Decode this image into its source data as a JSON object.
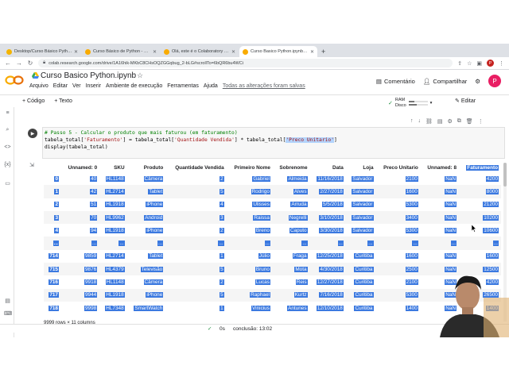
{
  "browser": {
    "tabs": [
      "Desktop/Curso Básico Python/",
      "Curso Básico de Python - Google",
      "Olá, este é o Colaboratory - Cola",
      "Curso Basico Python.ipynb - Cola"
    ],
    "url": "colab.research.google.com/drive/1A16hik-MKbC8CHsOQZGGqbug_2-bLG#scrollTo=6bQR6bu4WCi",
    "profile_initial": "P"
  },
  "colab": {
    "title": "Curso Basico Python.ipynb",
    "menus": [
      "Arquivo",
      "Editar",
      "Ver",
      "Inserir",
      "Ambiente de execução",
      "Ferramentas",
      "Ajuda"
    ],
    "saved": "Todas as alterações foram salvas",
    "comment": "Comentário",
    "share": "Compartilhar",
    "avatar": "P",
    "add_code": "+ Código",
    "add_text": "+ Texto",
    "ram": "RAM",
    "disk": "Disco",
    "edit": "Editar",
    "resources": {
      "ram_fraction": 0.3,
      "disk_fraction": 0.45
    }
  },
  "cell": {
    "lines": [
      "# Passo 5 - Calcular o produto que mais faturou (em faturamento)",
      "",
      "display(tabela_total)"
    ],
    "l2": {
      "a": "tabela_total[",
      "b": "'Faturamento'",
      "c": "] = tabela_total[",
      "d": "'Quantidade Vendida'",
      "e": "] * tabela_total[",
      "f": "'Preco Unitario'",
      "g": "]"
    }
  },
  "table": {
    "columns": [
      "Unnamed: 0",
      "SKU",
      "Produto",
      "Quantidade Vendida",
      "Primeiro Nome",
      "Sobrenome",
      "Data",
      "Loja",
      "Preco Unitario",
      "Unnamed: 8",
      "Faturamento"
    ],
    "rows": [
      [
        "0",
        "40",
        "HL1148",
        "Câmera",
        "2",
        "Gabriel",
        "Almeida",
        "11/16/2018",
        "Salvador",
        "2100",
        "NaN",
        "4200"
      ],
      [
        "1",
        "42",
        "HL2714",
        "Tablet",
        "5",
        "Rodrigo",
        "Alves",
        "2/27/2018",
        "Salvador",
        "1600",
        "NaN",
        "8000"
      ],
      [
        "2",
        "51",
        "HL1918",
        "iPhone",
        "4",
        "Ulisses",
        "Arruda",
        "5/5/2018",
        "Salvador",
        "5300",
        "NaN",
        "21200"
      ],
      [
        "3",
        "70",
        "HL9962",
        "Android",
        "3",
        "Raissa",
        "Negrelli",
        "3/10/2018",
        "Salvador",
        "3400",
        "NaN",
        "10200"
      ],
      [
        "4",
        "94",
        "HL1918",
        "iPhone",
        "2",
        "Breno",
        "Caputo",
        "3/30/2018",
        "Salvador",
        "5300",
        "NaN",
        "10600"
      ],
      [
        "...",
        "...",
        "...",
        "...",
        "...",
        "...",
        "...",
        "...",
        "...",
        "...",
        "...",
        "..."
      ],
      [
        "714",
        "9859",
        "HL2714",
        "Tablet",
        "1",
        "Júlio",
        "Fraga",
        "12/25/2018",
        "Curitiba",
        "1600",
        "NaN",
        "1600"
      ],
      [
        "715",
        "9876",
        "HL4379",
        "Televisão",
        "5",
        "Bruno",
        "Mota",
        "4/30/2018",
        "Curitiba",
        "2500",
        "NaN",
        "12500"
      ],
      [
        "716",
        "9918",
        "HL1148",
        "Câmera",
        "2",
        "Lucas",
        "Reis",
        "12/27/2018",
        "Curitiba",
        "2100",
        "NaN",
        "4200"
      ],
      [
        "717",
        "9944",
        "HL1918",
        "iPhone",
        "5",
        "Raphael",
        "Kurtz",
        "7/16/2018",
        "Curitiba",
        "5300",
        "NaN",
        "26500"
      ],
      [
        "718",
        "9998",
        "HL7348",
        "SmartWatch",
        "1",
        "Vinicius",
        "Antunes",
        "12/10/2018",
        "Curitiba",
        "1400",
        "NaN",
        "1400"
      ]
    ],
    "size": "9999 rows × 11 columns"
  },
  "status": {
    "duration": "0s",
    "completed": "conclusão: 13:02"
  },
  "colors": {
    "selection": "#3b79e0",
    "accent": "#f9ab00"
  }
}
